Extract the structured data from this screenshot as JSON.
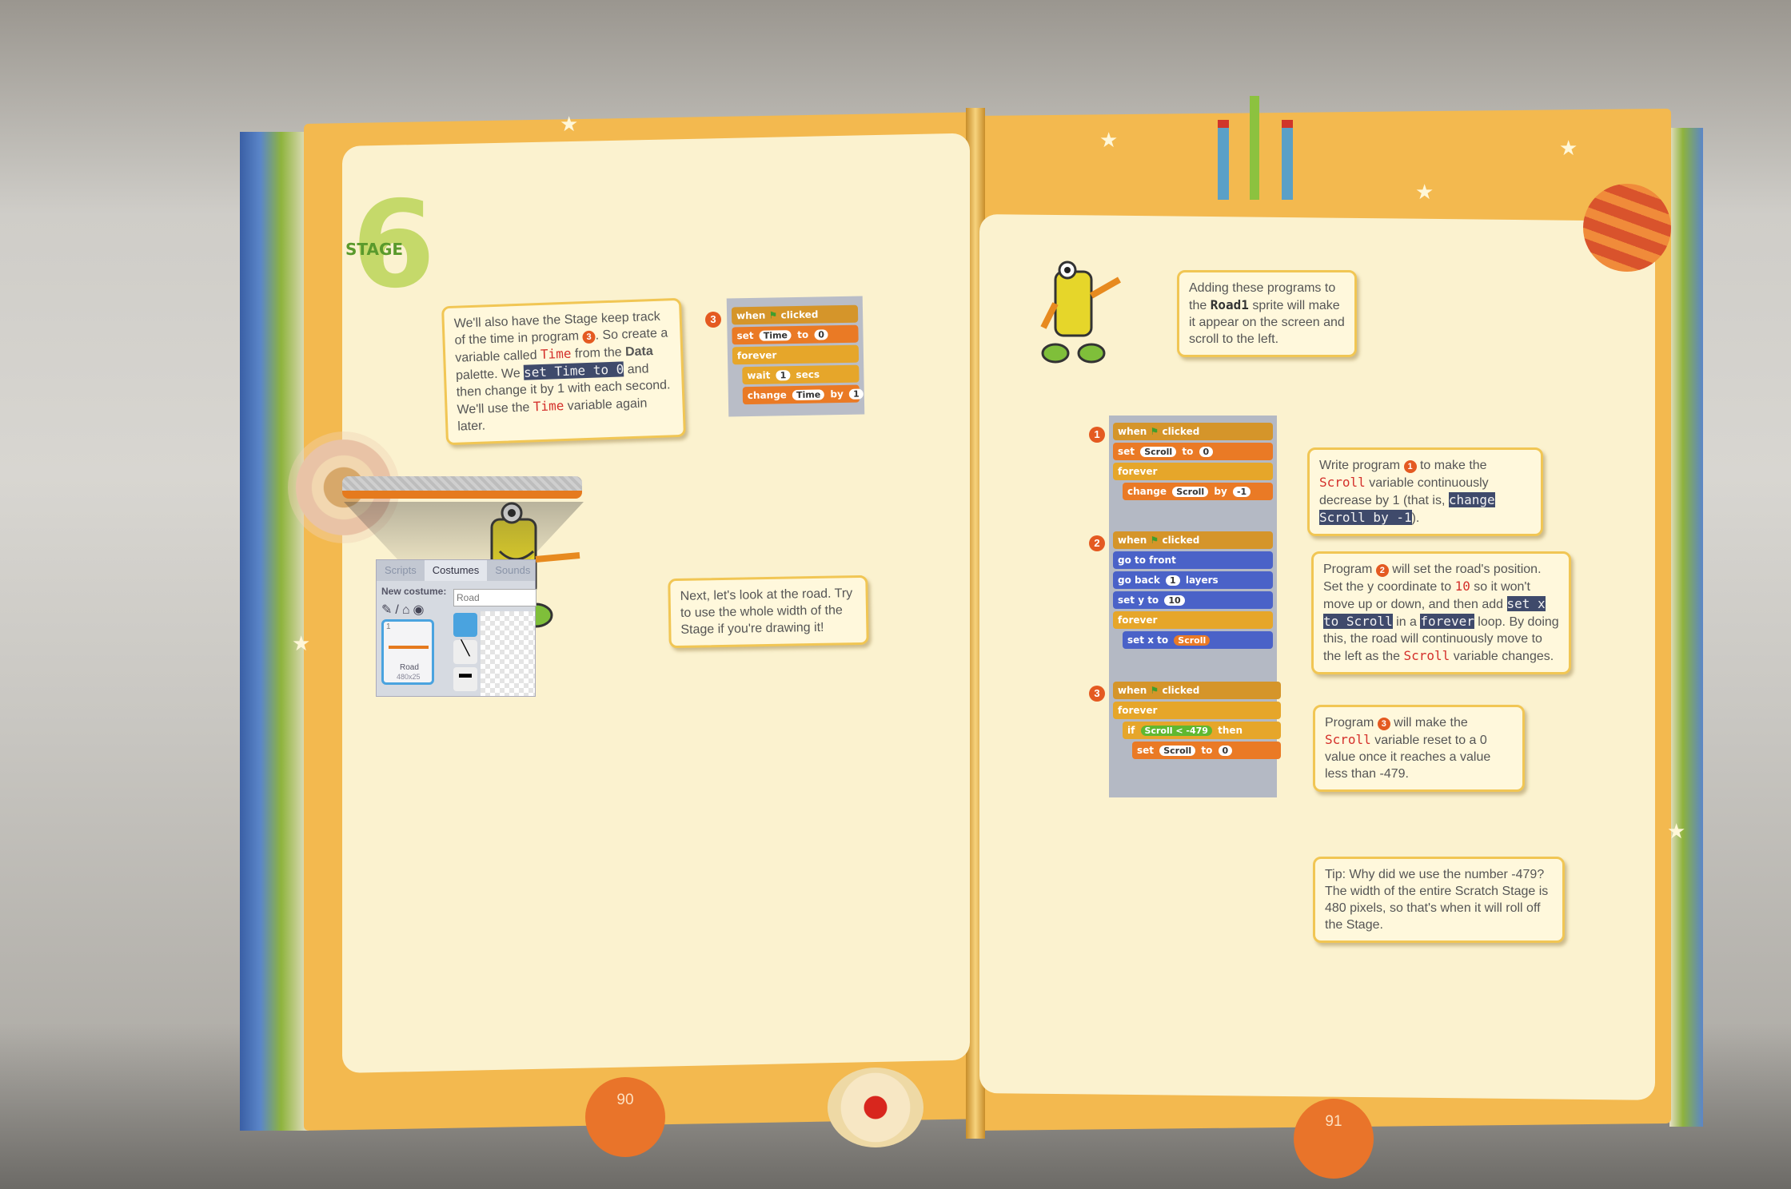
{
  "left_page": {
    "stage_label": "STAGE",
    "stage_number": "6",
    "intro_note": {
      "text_1": "We'll also have the Stage keep track of the time in program",
      "badge": "3",
      "text_2": ". So create a variable called",
      "var_time": "Time",
      "text_3": "from the",
      "data_word": "Data",
      "text_4": "palette. We",
      "highlight": "set Time to 0",
      "text_5": "and then change it by 1 with each second. We'll use the",
      "var_time_2": "Time",
      "text_6": "variable again later."
    },
    "program3": {
      "badge": "3",
      "blocks": [
        "when",
        "clicked",
        "set",
        "Time",
        "to",
        "0",
        "forever",
        "wait",
        "1",
        "secs",
        "change",
        "Time",
        "by",
        "1"
      ]
    },
    "road_note": "Next, let's look at the road. Try to use the whole width of the Stage if you're drawing it!",
    "editor": {
      "tabs": [
        "Scripts",
        "Costumes",
        "Sounds"
      ],
      "new_costume_label": "New costume:",
      "costume_name_value": "Road",
      "costume_label": "Road",
      "costume_size": "480x25",
      "costume_index": "1"
    },
    "page_number": "90"
  },
  "right_page": {
    "intro_note": {
      "text_1": "Adding these programs to the",
      "sprite": "Road1",
      "text_2": "sprite will make it appear on the screen and scroll to the left."
    },
    "program1": {
      "badge": "1",
      "blocks": [
        "when",
        "clicked",
        "set",
        "Scroll",
        "to",
        "0",
        "forever",
        "change",
        "Scroll",
        "by",
        "-1"
      ]
    },
    "program2": {
      "badge": "2",
      "blocks": [
        "when",
        "clicked",
        "go to front",
        "go back",
        "1",
        "layers",
        "set y to",
        "10",
        "forever",
        "set x to",
        "Scroll"
      ]
    },
    "program3": {
      "badge": "3",
      "blocks": [
        "when",
        "clicked",
        "forever",
        "if",
        "Scroll",
        "<",
        "-479",
        "then",
        "set",
        "Scroll",
        "to",
        "0"
      ]
    },
    "note1": {
      "text_1": "Write program",
      "badge": "1",
      "text_2": "to make the",
      "var": "Scroll",
      "text_3": "variable continuously decrease by 1 (that is,",
      "highlight": "change Scroll by -1",
      "text_4": ")."
    },
    "note2": {
      "text_1": "Program",
      "badge": "2",
      "text_2": "will set the road's position. Set the y coordinate to",
      "num": "10",
      "text_3": "so it won't move up or down, and then add",
      "highlight1": "set x to Scroll",
      "text_4": "in a",
      "highlight2": "forever",
      "text_5": "loop. By doing this, the road will continuously move to the left as the",
      "var": "Scroll",
      "text_6": "variable changes."
    },
    "note3": {
      "text_1": "Program",
      "badge": "3",
      "text_2": "will make the",
      "var": "Scroll",
      "text_3": "variable reset to a 0 value once it reaches a value less than -479."
    },
    "tip": "Tip: Why did we use the number -479? The width of the entire Scratch Stage is 480 pixels, so that's when it will roll off the Stage.",
    "page_number": "91"
  },
  "colors": {
    "page_orange": "#f3b94f",
    "panel_cream": "#fbf2cf",
    "note_border": "#f1c654",
    "accent_red": "#e45a21"
  }
}
